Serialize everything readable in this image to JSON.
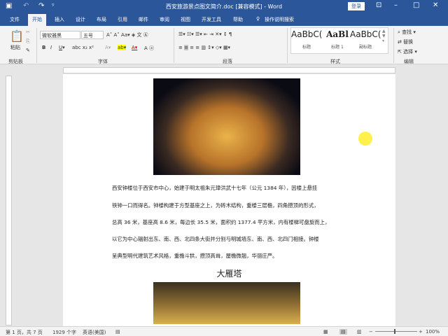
{
  "title": "西安旅游景点图文简介.doc [兼容模式] - Word",
  "login": "登录",
  "tabs": [
    "文件",
    "开始",
    "插入",
    "设计",
    "布局",
    "引用",
    "邮件",
    "审阅",
    "视图",
    "开发工具",
    "帮助",
    "操作说明搜索"
  ],
  "ribbon": {
    "paste": "粘贴",
    "clipboard": "剪贴板",
    "font_name": "微软雅黑",
    "font_size": "五号",
    "font_group": "字体",
    "para_group": "段落",
    "styles": [
      {
        "sample": "AaBbC(",
        "label": "标题"
      },
      {
        "sample": "AaBl",
        "label": "标题 1"
      },
      {
        "sample": "AaBbC(",
        "label": "副标题"
      }
    ],
    "styles_group": "样式",
    "find": "查找",
    "replace": "替换",
    "select": "选择",
    "edit_group": "编辑"
  },
  "document": {
    "paragraph": [
      "西安钟楼位于西安市中心，始建于明太祖朱元璋洪武十七年（公元 1384 年），因楼上悬挂",
      "铁钟一口而得名。钟楼构建于方型基座之上，为砖木结构，重楼三层檐，四角攒顶的形式，",
      "总高 36 米，基座高 8.6 米，每边长 35.5 米，面积约 1377.4 平方米，内有楼梯可盘旋而上，",
      "以它为中心辐射出东、南、西、北四条大街并分别与明城墙东、南、西、北四门相接。钟楼",
      "呈典型明代建筑艺术风格，重檐斗拱，攒顶高耸，屋檐微翘，华丽庄严。"
    ],
    "heading": "大雁塔"
  },
  "status": {
    "page": "第 1 页，共 7 页",
    "words": "1929 个字",
    "lang": "英语(美国)",
    "zoom": "100%"
  }
}
